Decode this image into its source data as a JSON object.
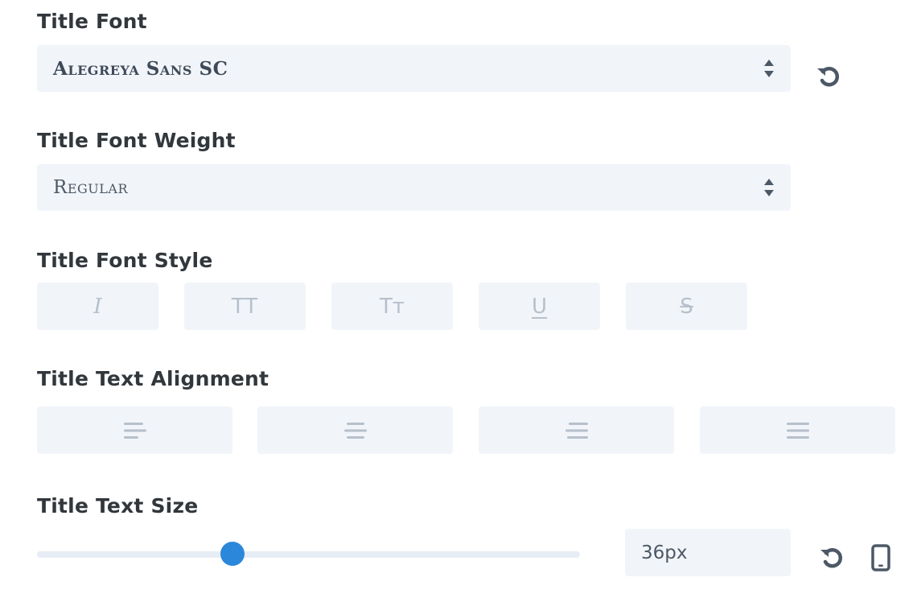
{
  "fields": {
    "title_font": {
      "label": "Title Font",
      "value": "Alegreya Sans SC"
    },
    "title_font_weight": {
      "label": "Title Font Weight",
      "value": "Regular"
    },
    "title_font_style": {
      "label": "Title Font Style",
      "buttons": [
        {
          "name": "italic",
          "glyph": "I"
        },
        {
          "name": "uppercase",
          "glyph": "TT"
        },
        {
          "name": "small-caps",
          "glyph": "Tᴛ"
        },
        {
          "name": "underline",
          "glyph": "U"
        },
        {
          "name": "strikethrough",
          "glyph": "S"
        }
      ]
    },
    "title_text_alignment": {
      "label": "Title Text Alignment",
      "options": [
        "left",
        "center",
        "right",
        "justify"
      ]
    },
    "title_text_size": {
      "label": "Title Text Size",
      "value": "36px",
      "slider_fraction": 0.36
    }
  },
  "icons": {
    "reset": "reset-icon",
    "responsive": "phone-icon",
    "select_arrows": "chevron-up-down-icon"
  },
  "colors": {
    "accent": "#2b87da",
    "field_bg": "#f1f5f9",
    "label_text": "#32373c",
    "icon_muted": "#b6c0cb",
    "icon_dark": "#4c5866"
  }
}
